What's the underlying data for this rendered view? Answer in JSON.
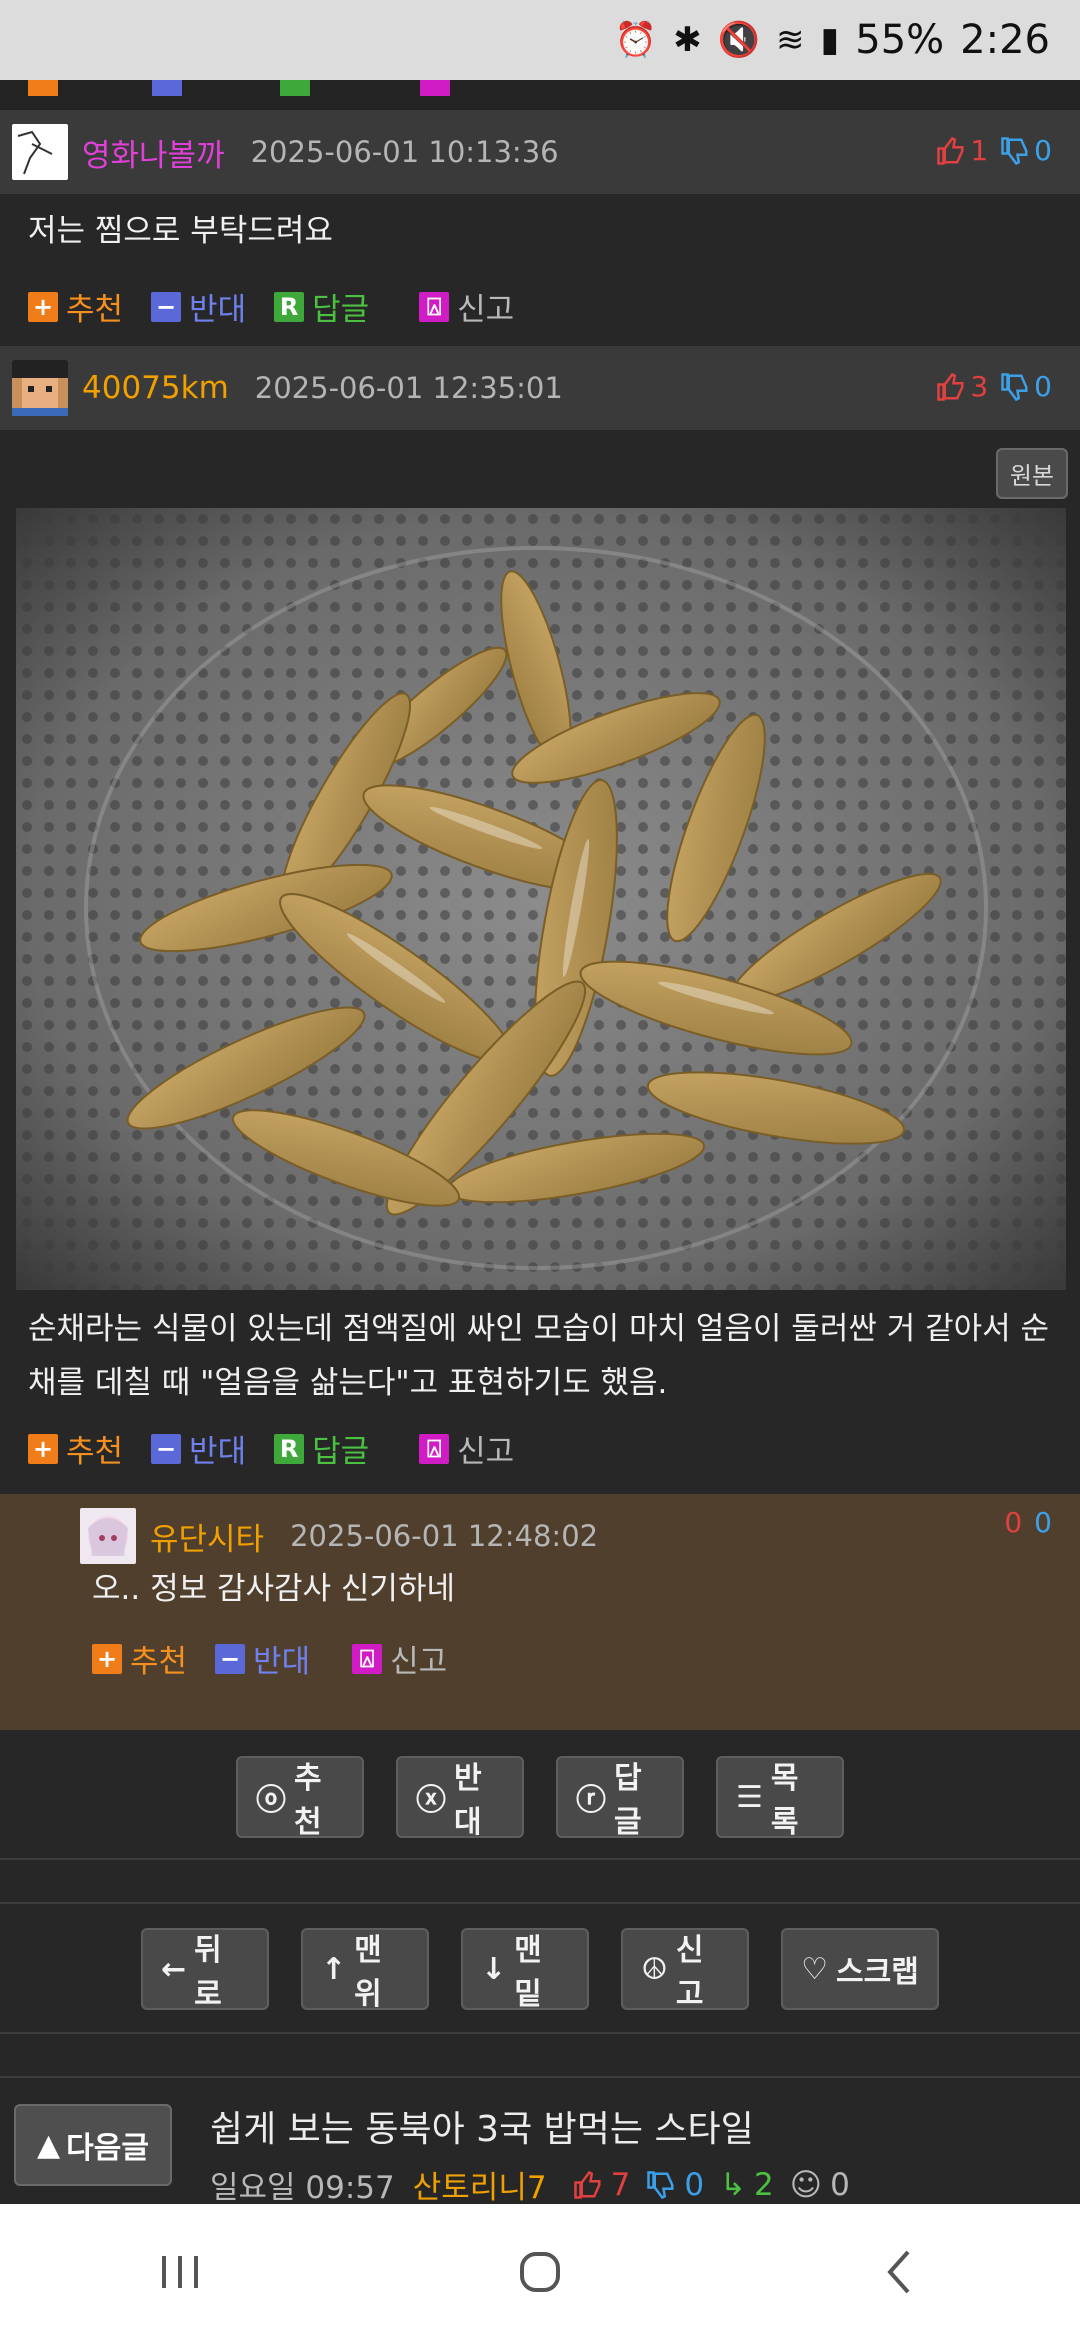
{
  "status": {
    "battery": "55%",
    "time": "2:26"
  },
  "comments": [
    {
      "nick": "영화나볼까",
      "nick_color": "#e040d8",
      "date": "2025-06-01 10:13:36",
      "up": "1",
      "down": "0",
      "body": "저는 찜으로 부탁드려요"
    },
    {
      "nick": "40075km",
      "nick_color": "#f0a000",
      "date": "2025-06-01 12:35:01",
      "up": "3",
      "down": "0",
      "original_label": "원본",
      "body": "순채라는 식물이 있는데 점액질에 싸인 모습이 마치 얼음이 둘러싼 거 같아서 순채를 데칠 때 \"얼음을 삶는다\"고 표현하기도 했음."
    }
  ],
  "reply": {
    "nick": "유단시타",
    "nick_color": "#f0a000",
    "date": "2025-06-01 12:48:02",
    "up": "0",
    "down": "0",
    "body": "오.. 정보 감사감사 신기하네"
  },
  "actions": {
    "recommend": "추천",
    "oppose": "반대",
    "reply": "답글",
    "report": "신고"
  },
  "post_buttons": {
    "recommend": "추천",
    "oppose": "반대",
    "reply": "답글",
    "list": "목록"
  },
  "nav_buttons": {
    "back": "뒤로",
    "top": "맨위",
    "bottom": "맨밑",
    "report": "신고",
    "scrap": "스크랩"
  },
  "next_post": {
    "label": "다음글",
    "title": "쉽게 보는 동북아 3국 밥먹는 스타일",
    "time": "일요일 09:57",
    "author": "산토리니7",
    "up": "7",
    "down": "0",
    "replies": "2",
    "views_icon_value": "0"
  },
  "colors": {
    "accent_orange": "#f5901e",
    "vote_up": "#e04040",
    "vote_down": "#3ca0e8",
    "reply_bg": "#4f3f2c"
  }
}
